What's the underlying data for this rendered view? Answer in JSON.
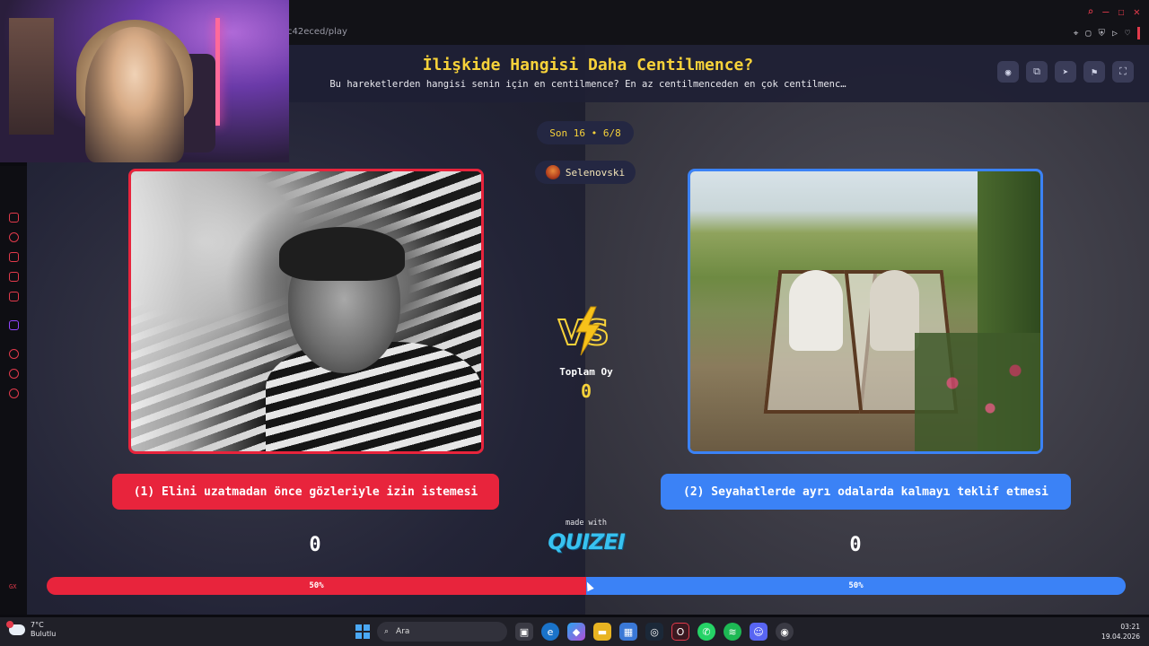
{
  "browser": {
    "url_fragment": "c42eced/play",
    "window_controls": [
      "search-icon",
      "minimize-icon",
      "maximize-icon",
      "close-icon"
    ],
    "extensions": [
      "pin-icon",
      "bookmark-icon",
      "shield-icon",
      "play-icon",
      "heart-icon"
    ]
  },
  "quiz": {
    "title": "İlişkide Hangisi Daha Centilmence?",
    "subtitle": "Bu hareketlerden hangisi senin için en centilmence? En az centilmenceden en çok centilmenc…",
    "header_buttons": [
      "eye-icon",
      "copy-icon",
      "send-icon",
      "flag-icon",
      "fullscreen-icon"
    ],
    "round": "Son 16 • 6/8",
    "user": "Selenovski",
    "total_label": "Toplam Oy",
    "total_votes": "0",
    "option_left": "(1) Elini uzatmadan önce gözleriyle izin istemesi",
    "option_right": "(2) Seyahatlerde ayrı odalarda kalmayı teklif etmesi",
    "score_left": "0",
    "score_right": "0",
    "made_with": "made with",
    "brand": "QUIZEI",
    "bar_left_label": "50%",
    "bar_right_label": "50%",
    "bar_left_fraction": 0.5,
    "colors": {
      "left": "#e8243c",
      "right": "#3b82f6",
      "accent": "#f7d23a"
    }
  },
  "sidebar": {
    "icons": [
      "gamepad-icon",
      "refresh-icon",
      "bag-icon",
      "chat-icon",
      "music-icon",
      "twitch-icon",
      "close-circle-icon",
      "clock-icon",
      "settings-icon"
    ],
    "bottom_label": "GX"
  },
  "taskbar": {
    "weather_temp": "7°C",
    "weather_desc": "Bulutlu",
    "search_placeholder": "Ara",
    "time": "03:21",
    "date": "19.04.2026"
  }
}
